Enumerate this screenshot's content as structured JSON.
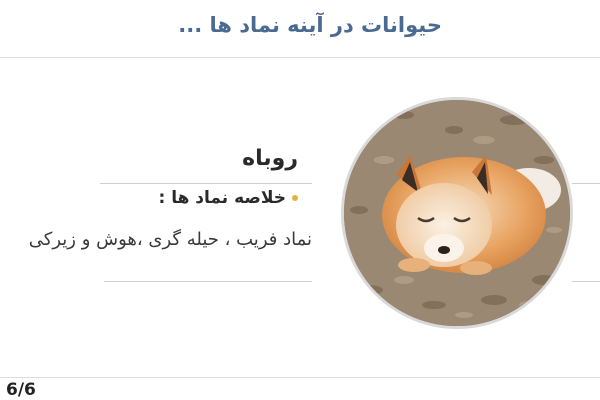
{
  "header": {
    "title": "حیوانات در آینه نماد ها ..."
  },
  "animal": {
    "name": "روباه",
    "summary_label": "خلاصه نماد ها :",
    "description": "نماد فریب ، حیله گری ،هوش و زیرکی",
    "image_alt": "red fox lying on leaves"
  },
  "footer": {
    "page_number": "6/6"
  },
  "colors": {
    "title": "#4a6a92",
    "bullet": "#e3b23c"
  }
}
